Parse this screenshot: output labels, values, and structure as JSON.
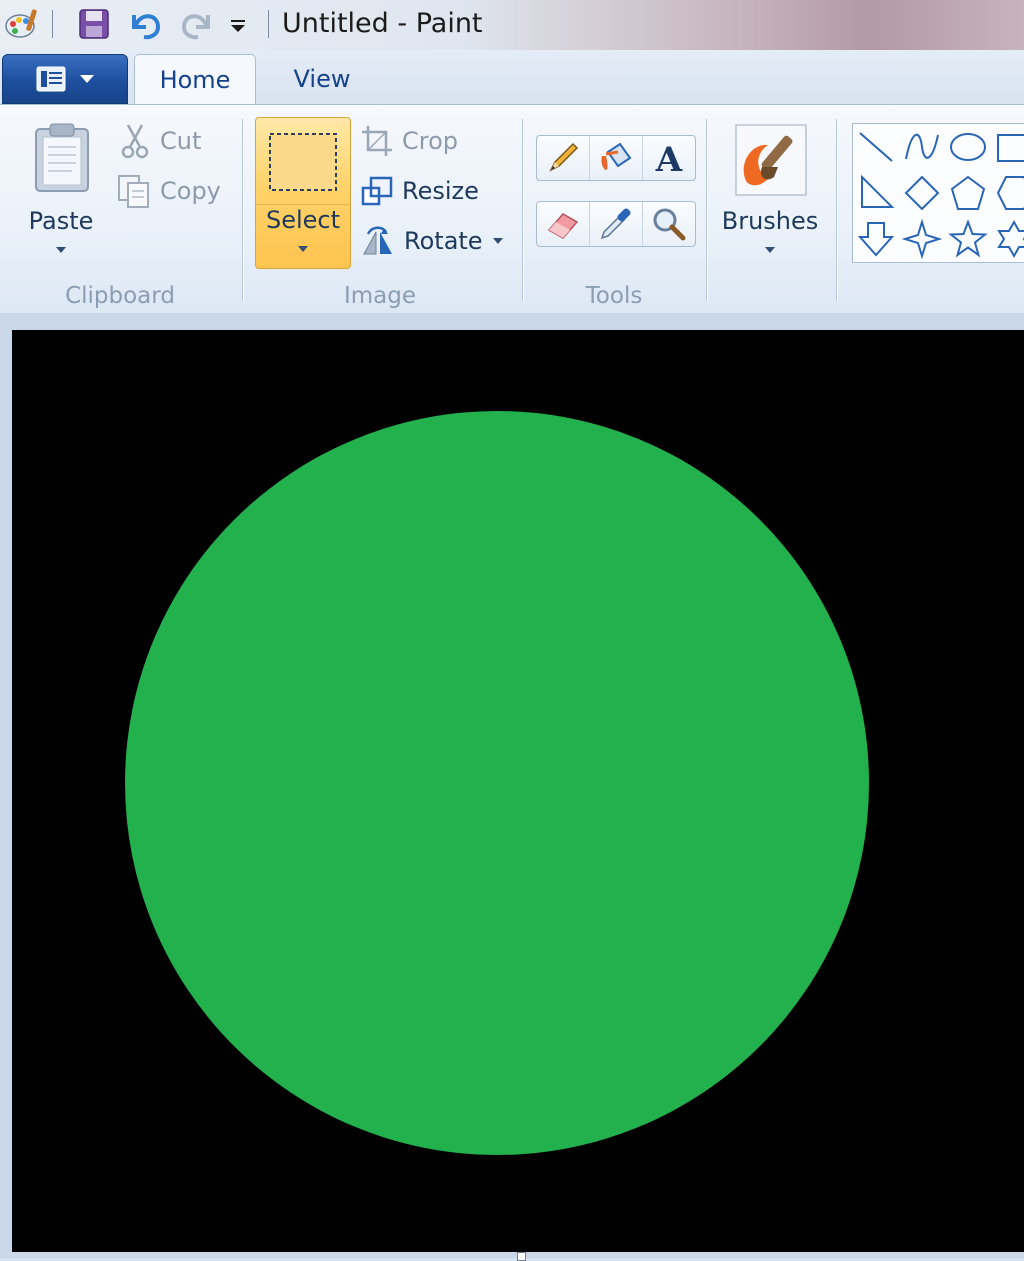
{
  "window": {
    "title": "Untitled - Paint"
  },
  "quick_access": {
    "icons": [
      "paint-app-icon",
      "save-icon",
      "undo-icon",
      "redo-icon",
      "customize-dropdown-icon"
    ]
  },
  "tabs": {
    "home_label": "Home",
    "view_label": "View",
    "active": "Home"
  },
  "ribbon": {
    "clipboard": {
      "label": "Clipboard",
      "paste_label": "Paste",
      "cut_label": "Cut",
      "copy_label": "Copy"
    },
    "image": {
      "label": "Image",
      "select_label": "Select",
      "crop_label": "Crop",
      "resize_label": "Resize",
      "rotate_label": "Rotate"
    },
    "tools": {
      "label": "Tools",
      "items": [
        "pencil",
        "fill-with-color",
        "text",
        "eraser",
        "color-picker",
        "magnifier"
      ]
    },
    "brushes": {
      "label": "Brushes"
    },
    "shapes": {
      "items": [
        "line",
        "curve",
        "oval",
        "rectangle",
        "right-triangle",
        "diamond",
        "pentagon",
        "hexagon",
        "arrow-down",
        "four-point-star",
        "five-point-star",
        "six-point-star"
      ]
    }
  },
  "canvas": {
    "background_color": "#000000",
    "circle_color": "#23b14d"
  },
  "colors": {
    "select_highlight": "#ffd36b",
    "app_menu": "#1d4f9e"
  }
}
